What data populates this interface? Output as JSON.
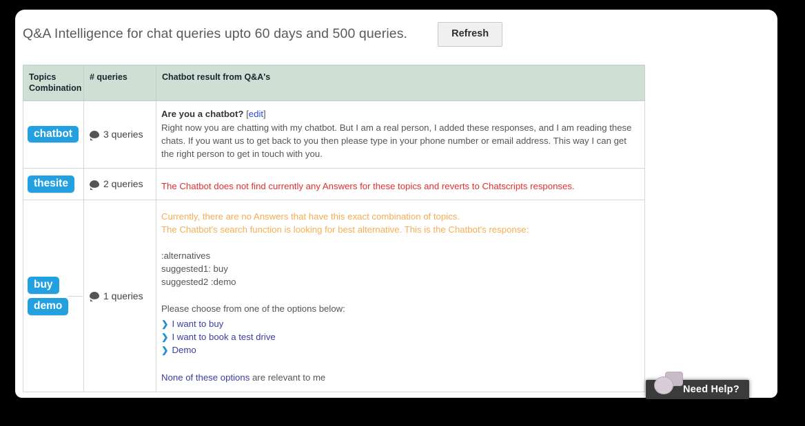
{
  "header": {
    "title": "Q&A Intelligence for chat queries upto 60 days and 500 queries.",
    "refresh_label": "Refresh"
  },
  "table": {
    "columns": [
      {
        "label": "Topics Combination"
      },
      {
        "label": "# queries"
      },
      {
        "label": "Chatbot result from Q&A's"
      }
    ],
    "rows": [
      {
        "tags": [
          "chatbot"
        ],
        "queries": "3 queries",
        "result_kind": "answer",
        "answer_title": "Are you a chatbot?",
        "edit_open": "[",
        "edit_label": "edit",
        "edit_close": "]",
        "answer_body": "Right now you are chatting with my chatbot. But I am a real person, I added these responses, and I am reading these chats. If you want us to get back to you then please type in your phone number or email address. This way I can get the right person to get in touch with you."
      },
      {
        "tags": [
          "thesite"
        ],
        "queries": "2 queries",
        "result_kind": "warning-red",
        "warning_red": "The Chatbot does not find currently any Answers for these topics and reverts to Chatscripts responses."
      },
      {
        "tags": [
          "buy",
          "demo"
        ],
        "queries": "1 queries",
        "result_kind": "fallback",
        "warning_orange_line1": "Currently, there are no Answers that have this exact combination of topics.",
        "warning_orange_line2": "The Chatbot's search function is looking for best alternative. This is the Chatbot's response:",
        "alternatives": [
          ":alternatives",
          "suggested1: buy",
          "suggested2 :demo"
        ],
        "choose_text": "Please choose from one of the options below:",
        "options": [
          "I want to buy",
          "I want to book a test drive",
          "Demo"
        ],
        "none_link": "None of these options",
        "none_rest": " are relevant to me"
      }
    ]
  },
  "widget": {
    "need_help_label": "Need Help?"
  },
  "colors": {
    "badge_blue": "#22a0e0",
    "header_green": "#cfdfd4",
    "warning_red": "#e03030",
    "warning_orange": "#f8ad52",
    "link_blue": "#3b3b9e",
    "chevron_blue": "#1f8fd0"
  },
  "icons": {
    "queries": "speech-bubble-icon",
    "chevron": "❯"
  }
}
